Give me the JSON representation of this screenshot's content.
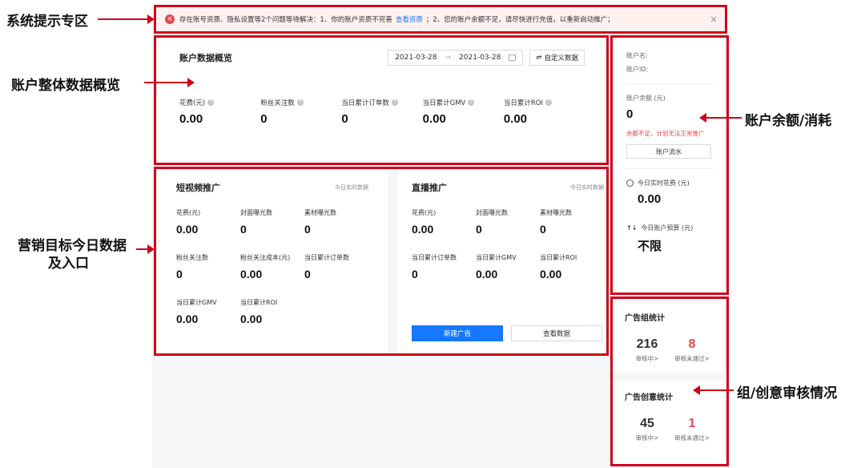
{
  "annotations": {
    "system_notice": "系统提示专区",
    "account_overview": "账户整体数据概览",
    "marketing_line1": "营销目标今日数据",
    "marketing_line2": "及入口",
    "balance": "账户余额/消耗",
    "audit": "组/创意审核情况"
  },
  "notice": {
    "prefix": "存在账号资质、隐私设置等2个问题等待解决：1、你的账户资质不完善",
    "link": "查看资质",
    "suffix": "；2、您的账户余额不足，请尽快进行充值，以重新启动推广；",
    "close": "×"
  },
  "overview": {
    "title": "账户数据概览",
    "date_start": "2021-03-28",
    "date_sep": "→",
    "date_end": "2021-03-28",
    "custom_button": "自定义数据",
    "metrics": [
      {
        "label": "花费(元)",
        "value": "0.00"
      },
      {
        "label": "粉丝关注数",
        "value": "0"
      },
      {
        "label": "当日累计订单数",
        "value": "0"
      },
      {
        "label": "当日累计GMV",
        "value": "0.00"
      },
      {
        "label": "当日累计ROI",
        "value": "0.00"
      }
    ]
  },
  "short_video": {
    "title": "短视频推广",
    "tag": "今日实时数据",
    "cells": [
      {
        "label": "花费(元)",
        "value": "0.00"
      },
      {
        "label": "封面曝光数",
        "value": "0"
      },
      {
        "label": "素材曝光数",
        "value": "0"
      },
      {
        "label": "粉丝关注数",
        "value": "0"
      },
      {
        "label": "粉丝关注成本(元)",
        "value": "0.00"
      },
      {
        "label": "当日累计订单数",
        "value": "0"
      },
      {
        "label": "当日累计GMV",
        "value": "0.00"
      },
      {
        "label": "当日累计ROI",
        "value": "0.00"
      }
    ]
  },
  "live": {
    "title": "直播推广",
    "tag": "今日实时数据",
    "cells": [
      {
        "label": "花费(元)",
        "value": "0.00"
      },
      {
        "label": "封面曝光数",
        "value": "0"
      },
      {
        "label": "素材曝光数",
        "value": "0"
      },
      {
        "label": "当日累计订单数",
        "value": "0"
      },
      {
        "label": "当日累计GMV",
        "value": "0.00"
      },
      {
        "label": "当日累计ROI",
        "value": "0.00"
      }
    ],
    "new_ad_button": "新建广告",
    "view_data_button": "查看数据"
  },
  "balance": {
    "account_name_label": "账户名:",
    "account_id_label": "账户ID:",
    "balance_label": "账户余额 (元)",
    "balance_value": "0",
    "warning": "余额不足，计划无法正常推广",
    "flow_button": "账户流水",
    "today_spend_label": "今日实时花费 (元)",
    "today_spend_value": "0.00",
    "budget_label": "今日账户预算 (元)",
    "budget_value": "不限"
  },
  "audit": {
    "group_title": "广告组统计",
    "group_reviewing": "216",
    "group_reviewing_label": "审核中>",
    "group_rejected": "8",
    "group_rejected_label": "审核未通过>",
    "creative_title": "广告创意统计",
    "creative_reviewing": "45",
    "creative_reviewing_label": "审核中>",
    "creative_rejected": "1",
    "creative_rejected_label": "审核未通过>"
  },
  "colors": {
    "annotation_red": "#d0021b",
    "primary_blue": "#1677ff",
    "warning_red": "#e5484d"
  }
}
